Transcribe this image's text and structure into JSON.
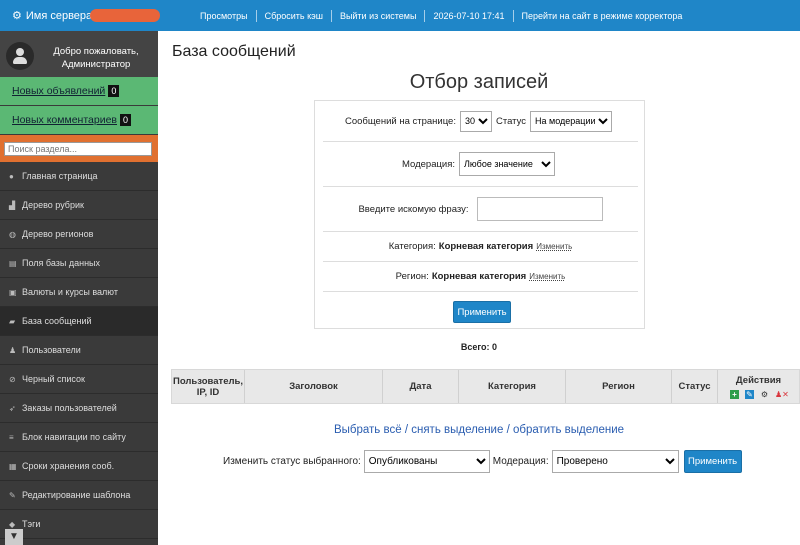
{
  "topbar": {
    "server_label": "Имя сервера",
    "links": [
      "Просмотры",
      "Сбросить кэш",
      "Выйти из системы",
      "2026-07-10 17:41",
      "Перейти на сайт в режиме корректора"
    ]
  },
  "sidebar": {
    "welcome": "Добро пожаловать, Администратор",
    "new_ads_label": "Новых объявлений",
    "new_ads_count": "0",
    "new_comments_label": "Новых комментариев",
    "new_comments_count": "0",
    "search_placeholder": "Поиск раздела...",
    "items": [
      {
        "label": "Главная страница",
        "icon": "info-icon"
      },
      {
        "label": "Дерево рубрик",
        "icon": "sitemap-icon"
      },
      {
        "label": "Дерево регионов",
        "icon": "globe-icon"
      },
      {
        "label": "Поля базы данных",
        "icon": "list-icon"
      },
      {
        "label": "Валюты и курсы валют",
        "icon": "money-icon"
      },
      {
        "label": "База сообщений",
        "icon": "folder-open-icon"
      },
      {
        "label": "Пользователи",
        "icon": "user-plus-icon"
      },
      {
        "label": "Черный список",
        "icon": "ban-icon"
      },
      {
        "label": "Заказы пользователей",
        "icon": "rocket-icon"
      },
      {
        "label": "Блок навигации по сайту",
        "icon": "bars-icon"
      },
      {
        "label": "Сроки хранения сооб.",
        "icon": "calendar-icon"
      },
      {
        "label": "Редактирование шаблона",
        "icon": "edit-icon"
      },
      {
        "label": "Тэги",
        "icon": "tag-icon"
      }
    ]
  },
  "main": {
    "page_title": "База сообщений",
    "filter_title": "Отбор записей",
    "per_page_label": "Сообщений на странице:",
    "per_page_value": "30",
    "status_label": "Статус",
    "status_value": "На модерации",
    "moderation_label": "Модерация:",
    "moderation_value": "Любое значение",
    "search_label": "Введите искомую фразу:",
    "category_label": "Категория:",
    "category_value": "Корневая категория",
    "region_label": "Регион:",
    "region_value": "Корневая категория",
    "change_link": "Изменить",
    "apply_label": "Применить",
    "total_label": "Всего: 0",
    "table_headers": [
      "Пользователь, IP, ID",
      "Заголовок",
      "Дата",
      "Категория",
      "Регион",
      "Статус",
      "Действия"
    ],
    "select_all": "Выбрать всё",
    "deselect": "снять выделение",
    "invert": "обратить выделение",
    "change_status_label": "Изменить статус выбранного:",
    "change_status_value": "Опубликованы",
    "moderation2_label": "Модерация:",
    "moderation2_value": "Проверено"
  }
}
